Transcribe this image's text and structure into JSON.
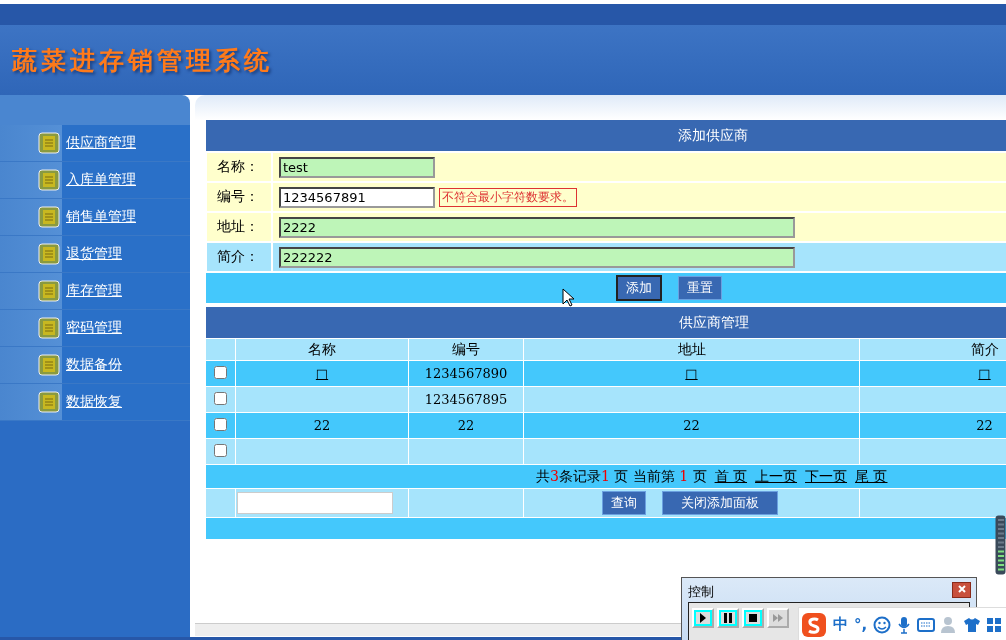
{
  "header": {
    "title": "蔬菜进存销管理系统"
  },
  "sidebar": {
    "items": [
      {
        "label": "供应商管理"
      },
      {
        "label": "入库单管理"
      },
      {
        "label": "销售单管理"
      },
      {
        "label": "退货管理"
      },
      {
        "label": "库存管理"
      },
      {
        "label": "密码管理"
      },
      {
        "label": "数据备份"
      },
      {
        "label": "数据恢复"
      }
    ]
  },
  "add_form": {
    "title": "添加供应商",
    "fields": [
      {
        "label": "名称：",
        "value": "test",
        "valid": true,
        "wide": false
      },
      {
        "label": "编号：",
        "value": "1234567891",
        "valid": false,
        "wide": false,
        "error": "不符合最小字符数要求。"
      },
      {
        "label": "地址：",
        "value": "2222",
        "valid": true,
        "wide": true
      },
      {
        "label": "简介：",
        "value": "222222",
        "valid": true,
        "wide": true
      }
    ],
    "buttons": [
      {
        "label": "添加",
        "focused": true
      },
      {
        "label": "重置",
        "focused": false
      }
    ]
  },
  "supplier_table": {
    "title": "供应商管理",
    "columns": [
      "名称",
      "编号",
      "地址",
      "简介"
    ],
    "rows": [
      {
        "checked": false,
        "cells": [
          "□",
          "1234567890",
          "□",
          "□"
        ]
      },
      {
        "checked": false,
        "cells": [
          "",
          "1234567895",
          "",
          ""
        ]
      },
      {
        "checked": false,
        "cells": [
          "22",
          "22",
          "22",
          "22"
        ]
      },
      {
        "checked": false,
        "cells": [
          "",
          "",
          "",
          ""
        ]
      }
    ],
    "pager": {
      "segments": [
        {
          "text": "共",
          "emphasis": false
        },
        {
          "text": "3",
          "emphasis": true
        },
        {
          "text": "条记录",
          "emphasis": false
        },
        {
          "text": "1",
          "emphasis": true
        },
        {
          "text": " 页 当前第 ",
          "emphasis": false
        },
        {
          "text": "1",
          "emphasis": true
        },
        {
          "text": " 页",
          "emphasis": false
        }
      ],
      "links": [
        "首 页",
        "上一页",
        "下一页",
        "尾 页"
      ]
    },
    "search_button": "查询",
    "close_panel_button": "关闭添加面板"
  },
  "control_window": {
    "title": "控制",
    "buttons": [
      {
        "kind": "play",
        "enabled": true
      },
      {
        "kind": "pause",
        "enabled": true
      },
      {
        "kind": "stop",
        "enabled": true
      },
      {
        "kind": "forward",
        "enabled": false
      }
    ]
  },
  "ime_bar": {
    "mode": "中",
    "punctuation": "°,"
  }
}
